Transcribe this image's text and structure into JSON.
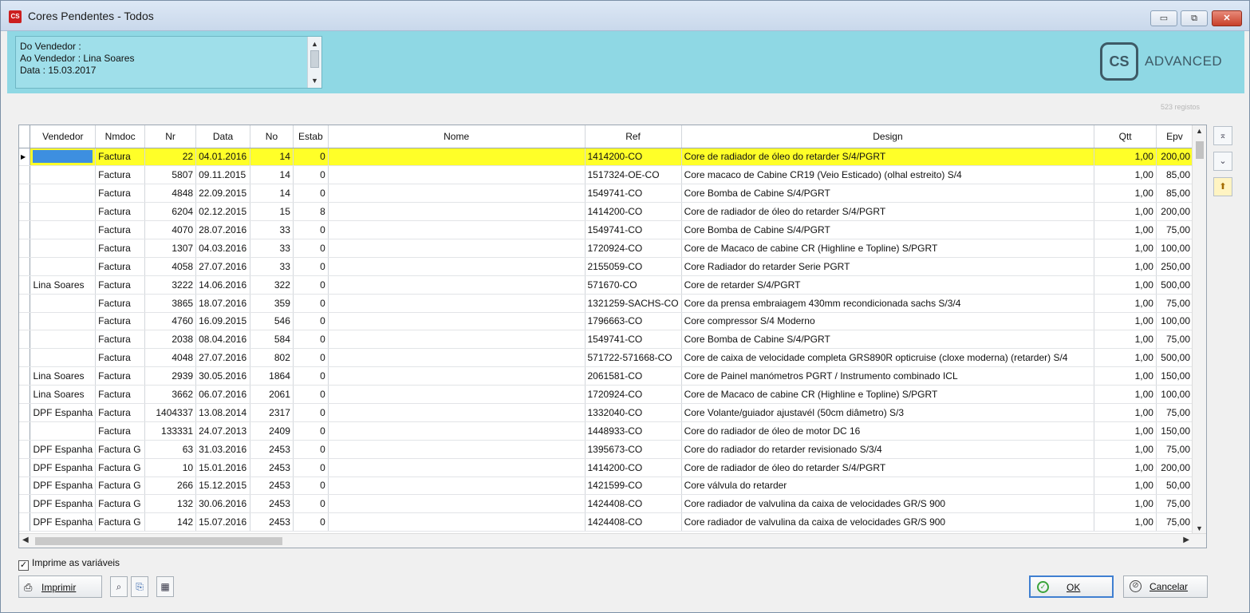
{
  "window": {
    "title": "Cores Pendentes - Todos",
    "app_icon_text": "CS"
  },
  "header": {
    "info_lines": [
      "Do Vendedor :",
      "Ao Vendedor : Lina Soares",
      "Data : 15.03.2017"
    ],
    "logo_text": "ADVANCED",
    "logo_mark": "CS"
  },
  "record_count": "523 registos",
  "grid": {
    "columns": [
      "Vendedor",
      "Nmdoc",
      "Nr",
      "Data",
      "No",
      "Estab",
      "Nome",
      "Ref",
      "Design",
      "Qtt",
      "Epv"
    ],
    "rows": [
      [
        "",
        "Factura",
        "22",
        "04.01.2016",
        "14",
        "0",
        "",
        "1414200-CO",
        "Core de radiador de óleo do retarder  S/4/PGRT",
        "1,00",
        "200,00"
      ],
      [
        "",
        "Factura",
        "5807",
        "09.11.2015",
        "14",
        "0",
        "",
        "1517324-OE-CO",
        "Core macaco de Cabine CR19 (Veio Esticado) (olhal estreito)  S/4",
        "1,00",
        "85,00"
      ],
      [
        "",
        "Factura",
        "4848",
        "22.09.2015",
        "14",
        "0",
        "",
        "1549741-CO",
        "Core Bomba de Cabine S/4/PGRT",
        "1,00",
        "85,00"
      ],
      [
        "",
        "Factura",
        "6204",
        "02.12.2015",
        "15",
        "8",
        "",
        "1414200-CO",
        "Core de radiador de óleo do retarder  S/4/PGRT",
        "1,00",
        "200,00"
      ],
      [
        "",
        "Factura",
        "4070",
        "28.07.2016",
        "33",
        "0",
        "",
        "1549741-CO",
        "Core Bomba de Cabine S/4/PGRT",
        "1,00",
        "75,00"
      ],
      [
        "",
        "Factura",
        "1307",
        "04.03.2016",
        "33",
        "0",
        "",
        "1720924-CO",
        "Core de Macaco de cabine CR (Highline e Topline) S/PGRT",
        "1,00",
        "100,00"
      ],
      [
        "",
        "Factura",
        "4058",
        "27.07.2016",
        "33",
        "0",
        "",
        "2155059-CO",
        "Core Radiador do retarder Serie PGRT",
        "1,00",
        "250,00"
      ],
      [
        "Lina Soares",
        "Factura",
        "3222",
        "14.06.2016",
        "322",
        "0",
        "",
        "571670-CO",
        "Core de retarder   S/4/PGRT",
        "1,00",
        "500,00"
      ],
      [
        "",
        "Factura",
        "3865",
        "18.07.2016",
        "359",
        "0",
        "",
        "1321259-SACHS-CO",
        "Core da prensa embraiagem 430mm recondicionada sachs S/3/4",
        "1,00",
        "75,00"
      ],
      [
        "",
        "Factura",
        "4760",
        "16.09.2015",
        "546",
        "0",
        "",
        "1796663-CO",
        "Core compressor S/4 Moderno",
        "1,00",
        "100,00"
      ],
      [
        "",
        "Factura",
        "2038",
        "08.04.2016",
        "584",
        "0",
        "",
        "1549741-CO",
        "Core Bomba de Cabine S/4/PGRT",
        "1,00",
        "75,00"
      ],
      [
        "",
        "Factura",
        "4048",
        "27.07.2016",
        "802",
        "0",
        "",
        "571722-571668-CO",
        "Core de caixa de velocidade completa GRS890R opticruise (cloxe moderna) (retarder) S/4",
        "1,00",
        "500,00"
      ],
      [
        "Lina Soares",
        "Factura",
        "2939",
        "30.05.2016",
        "1864",
        "0",
        "",
        "2061581-CO",
        "Core de Painel manómetros PGRT / Instrumento combinado ICL",
        "1,00",
        "150,00"
      ],
      [
        "Lina Soares",
        "Factura",
        "3662",
        "06.07.2016",
        "2061",
        "0",
        "",
        "1720924-CO",
        "Core de Macaco de cabine CR (Highline e Topline) S/PGRT",
        "1,00",
        "100,00"
      ],
      [
        "DPF Espanha",
        "Factura",
        "1404337",
        "13.08.2014",
        "2317",
        "0",
        "",
        "1332040-CO",
        "Core Volante/guiador ajustavél (50cm diâmetro)  S/3",
        "1,00",
        "75,00"
      ],
      [
        "",
        "Factura",
        "133331",
        "24.07.2013",
        "2409",
        "0",
        "",
        "1448933-CO",
        "Core do radiador de óleo de motor DC 16",
        "1,00",
        "150,00"
      ],
      [
        "DPF Espanha",
        "Factura G",
        "63",
        "31.03.2016",
        "2453",
        "0",
        "",
        "1395673-CO",
        "Core do radiador do retarder revisionado S/3/4",
        "1,00",
        "75,00"
      ],
      [
        "DPF Espanha",
        "Factura G",
        "10",
        "15.01.2016",
        "2453",
        "0",
        "",
        "1414200-CO",
        "Core de radiador de óleo do retarder  S/4/PGRT",
        "1,00",
        "200,00"
      ],
      [
        "DPF Espanha",
        "Factura G",
        "266",
        "15.12.2015",
        "2453",
        "0",
        "",
        "1421599-CO",
        "Core válvula do retarder",
        "1,00",
        "50,00"
      ],
      [
        "DPF Espanha",
        "Factura G",
        "132",
        "30.06.2016",
        "2453",
        "0",
        "",
        "1424408-CO",
        "Core radiador de valvulina da caixa de velocidades GR/S 900",
        "1,00",
        "75,00"
      ],
      [
        "DPF Espanha",
        "Factura G",
        "142",
        "15.07.2016",
        "2453",
        "0",
        "",
        "1424408-CO",
        "Core radiador de valvulina da caixa de velocidades GR/S 900",
        "1,00",
        "75,00"
      ]
    ],
    "selected_row": 0
  },
  "footer": {
    "checkbox_label": "Imprime as variáveis",
    "checkbox_checked": true,
    "print_label": "Imprimir",
    "ok_label": "OK",
    "cancel_label": "Cancelar"
  },
  "colors": {
    "header_band": "#8fd8e4",
    "selected_row": "#ffff28",
    "focus_cell": "#3d8fe0"
  }
}
